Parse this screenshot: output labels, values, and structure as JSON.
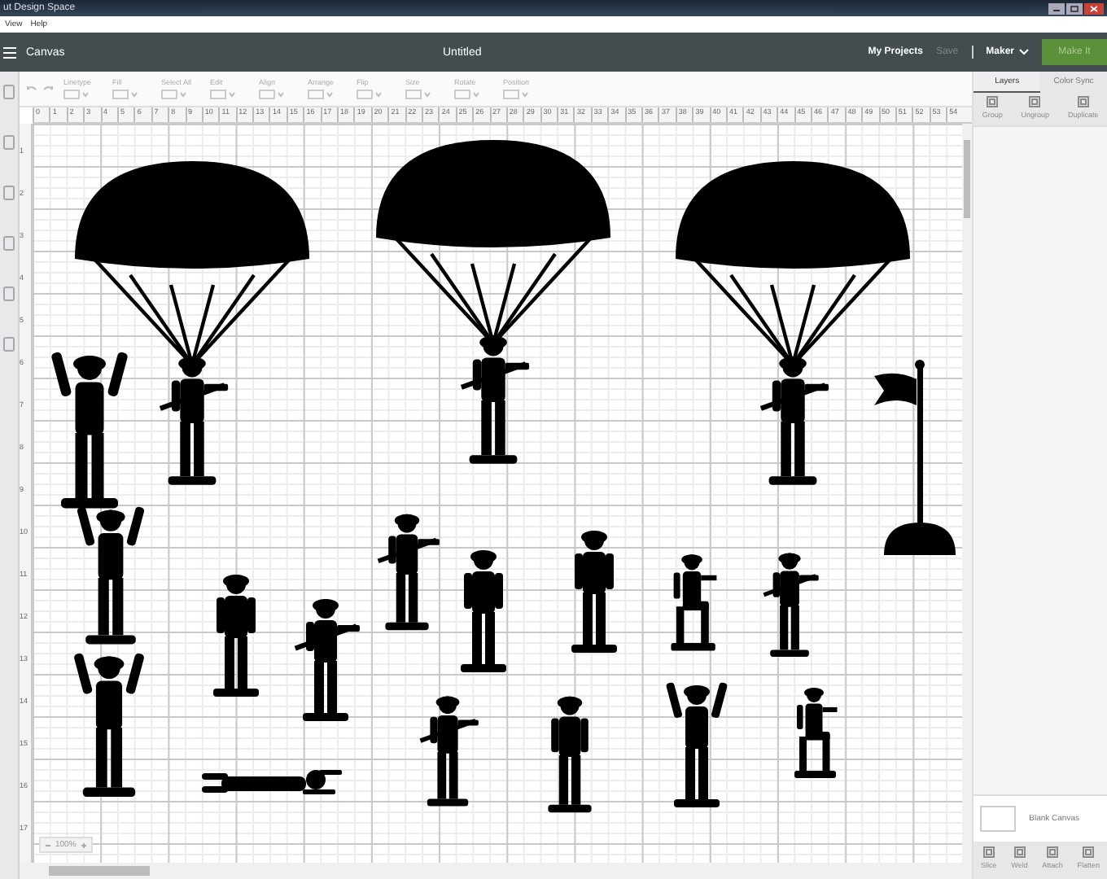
{
  "window": {
    "title": "ut Design Space"
  },
  "menu": [
    "View",
    "Help"
  ],
  "header": {
    "section": "Canvas",
    "title": "Untitled",
    "links": [
      {
        "label": "My Projects",
        "disabled": false
      },
      {
        "label": "Save",
        "disabled": true
      }
    ],
    "machine": "Maker",
    "make_button": "Make It"
  },
  "toolbar": [
    {
      "label": "Linetype"
    },
    {
      "label": "Fill"
    },
    {
      "label": "Select All"
    },
    {
      "label": "Edit"
    },
    {
      "label": "Align"
    },
    {
      "label": "Arrange"
    },
    {
      "label": "Flip"
    },
    {
      "label": "Size"
    },
    {
      "label": "Rotate"
    },
    {
      "label": "Position"
    }
  ],
  "ruler": {
    "horizontal": [
      "0",
      "1",
      "2",
      "3",
      "4",
      "5",
      "6",
      "7",
      "8",
      "9",
      "10",
      "11",
      "12",
      "13",
      "14",
      "15",
      "16",
      "17",
      "18",
      "19",
      "20",
      "21",
      "22",
      "23",
      "24",
      "25",
      "26",
      "27",
      "28",
      "29",
      "30",
      "31",
      "32",
      "33",
      "34",
      "35",
      "36",
      "37",
      "38",
      "39",
      "40",
      "41",
      "42",
      "43",
      "44",
      "45",
      "46",
      "47",
      "48",
      "49",
      "50",
      "51",
      "52",
      "53",
      "54"
    ],
    "vertical": [
      "1",
      "2",
      "3",
      "4",
      "5",
      "6",
      "7",
      "8",
      "9",
      "10",
      "11",
      "12",
      "13",
      "14",
      "15",
      "16",
      "17"
    ]
  },
  "canvas": {
    "figures": [
      {
        "kind": "parachutist"
      },
      {
        "kind": "parachutist"
      },
      {
        "kind": "parachutist"
      },
      {
        "kind": "flag"
      },
      {
        "kind": "arms-up"
      },
      {
        "kind": "arms-up"
      },
      {
        "kind": "standing"
      },
      {
        "kind": "rifle"
      },
      {
        "kind": "rifle"
      },
      {
        "kind": "standing"
      },
      {
        "kind": "standing"
      },
      {
        "kind": "kneeling"
      },
      {
        "kind": "rifle"
      },
      {
        "kind": "arms-up"
      },
      {
        "kind": "lying"
      },
      {
        "kind": "rifle"
      },
      {
        "kind": "standing"
      },
      {
        "kind": "arms-up"
      },
      {
        "kind": "kneeling"
      }
    ],
    "zoom": "100%"
  },
  "panel": {
    "tabs": [
      {
        "label": "Layers",
        "selected": true
      },
      {
        "label": "Color Sync",
        "selected": false
      }
    ],
    "actions": [
      {
        "label": "Group",
        "disabled": true
      },
      {
        "label": "Ungroup",
        "disabled": true
      },
      {
        "label": "Duplicate",
        "disabled": true
      }
    ],
    "canvas_layer": "Blank Canvas",
    "bottom_actions": [
      {
        "label": "Slice",
        "disabled": true
      },
      {
        "label": "Weld",
        "disabled": true
      },
      {
        "label": "Attach",
        "disabled": true
      },
      {
        "label": "Flatten",
        "disabled": true
      }
    ]
  }
}
